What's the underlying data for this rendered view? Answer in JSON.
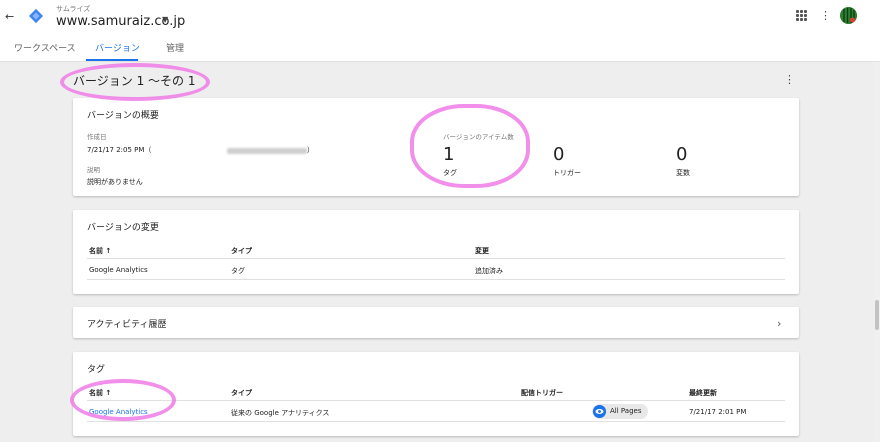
{
  "topbar": {
    "back_icon": "arrow-left-icon",
    "account_name": "サムライズ",
    "container_name": "www.samuraiz.co.jp",
    "caret_icon": "caret-down-icon",
    "apps_icon": "apps-grid-icon",
    "menu_icon": "more-vert-icon",
    "avatar_icon": "watermelon-avatar"
  },
  "tabs": [
    {
      "label": "ワークスペース"
    },
    {
      "label": "バージョン"
    },
    {
      "label": "管理"
    }
  ],
  "page": {
    "title": "バージョン 1 ～その 1",
    "menu_icon": "more-vert-icon"
  },
  "summary": {
    "title": "バージョンの概要",
    "created_label": "作成日",
    "created_value": "7/21/17 2:05 PM（",
    "created_suffix": "）",
    "description_label": "説明",
    "description_value": "説明がありません",
    "items_label": "バージョンのアイテム数",
    "counts": [
      {
        "value": "1",
        "label": "タグ"
      },
      {
        "value": "0",
        "label": "トリガー"
      },
      {
        "value": "0",
        "label": "変数"
      }
    ]
  },
  "changes": {
    "title": "バージョンの変更",
    "headers": [
      "名前 ↑",
      "タイプ",
      "変更"
    ],
    "rows": [
      {
        "name": "Google Analytics",
        "type": "タグ",
        "change": "追加済み"
      }
    ]
  },
  "activity": {
    "title": "アクティビティ履歴",
    "chevron_icon": "chevron-right-icon"
  },
  "tags": {
    "title": "タグ",
    "headers": [
      "名前 ↑",
      "タイプ",
      "配信トリガー",
      "最終更新"
    ],
    "rows": [
      {
        "name": "Google Analytics",
        "type": "従来の Google アナリティクス",
        "trigger": "All Pages",
        "trigger_icon": "eye-icon",
        "updated": "7/21/17 2:01 PM"
      }
    ]
  },
  "colors": {
    "accent": "#1a73e8",
    "highlight": "#ee7be6",
    "background": "#eeeeee"
  }
}
